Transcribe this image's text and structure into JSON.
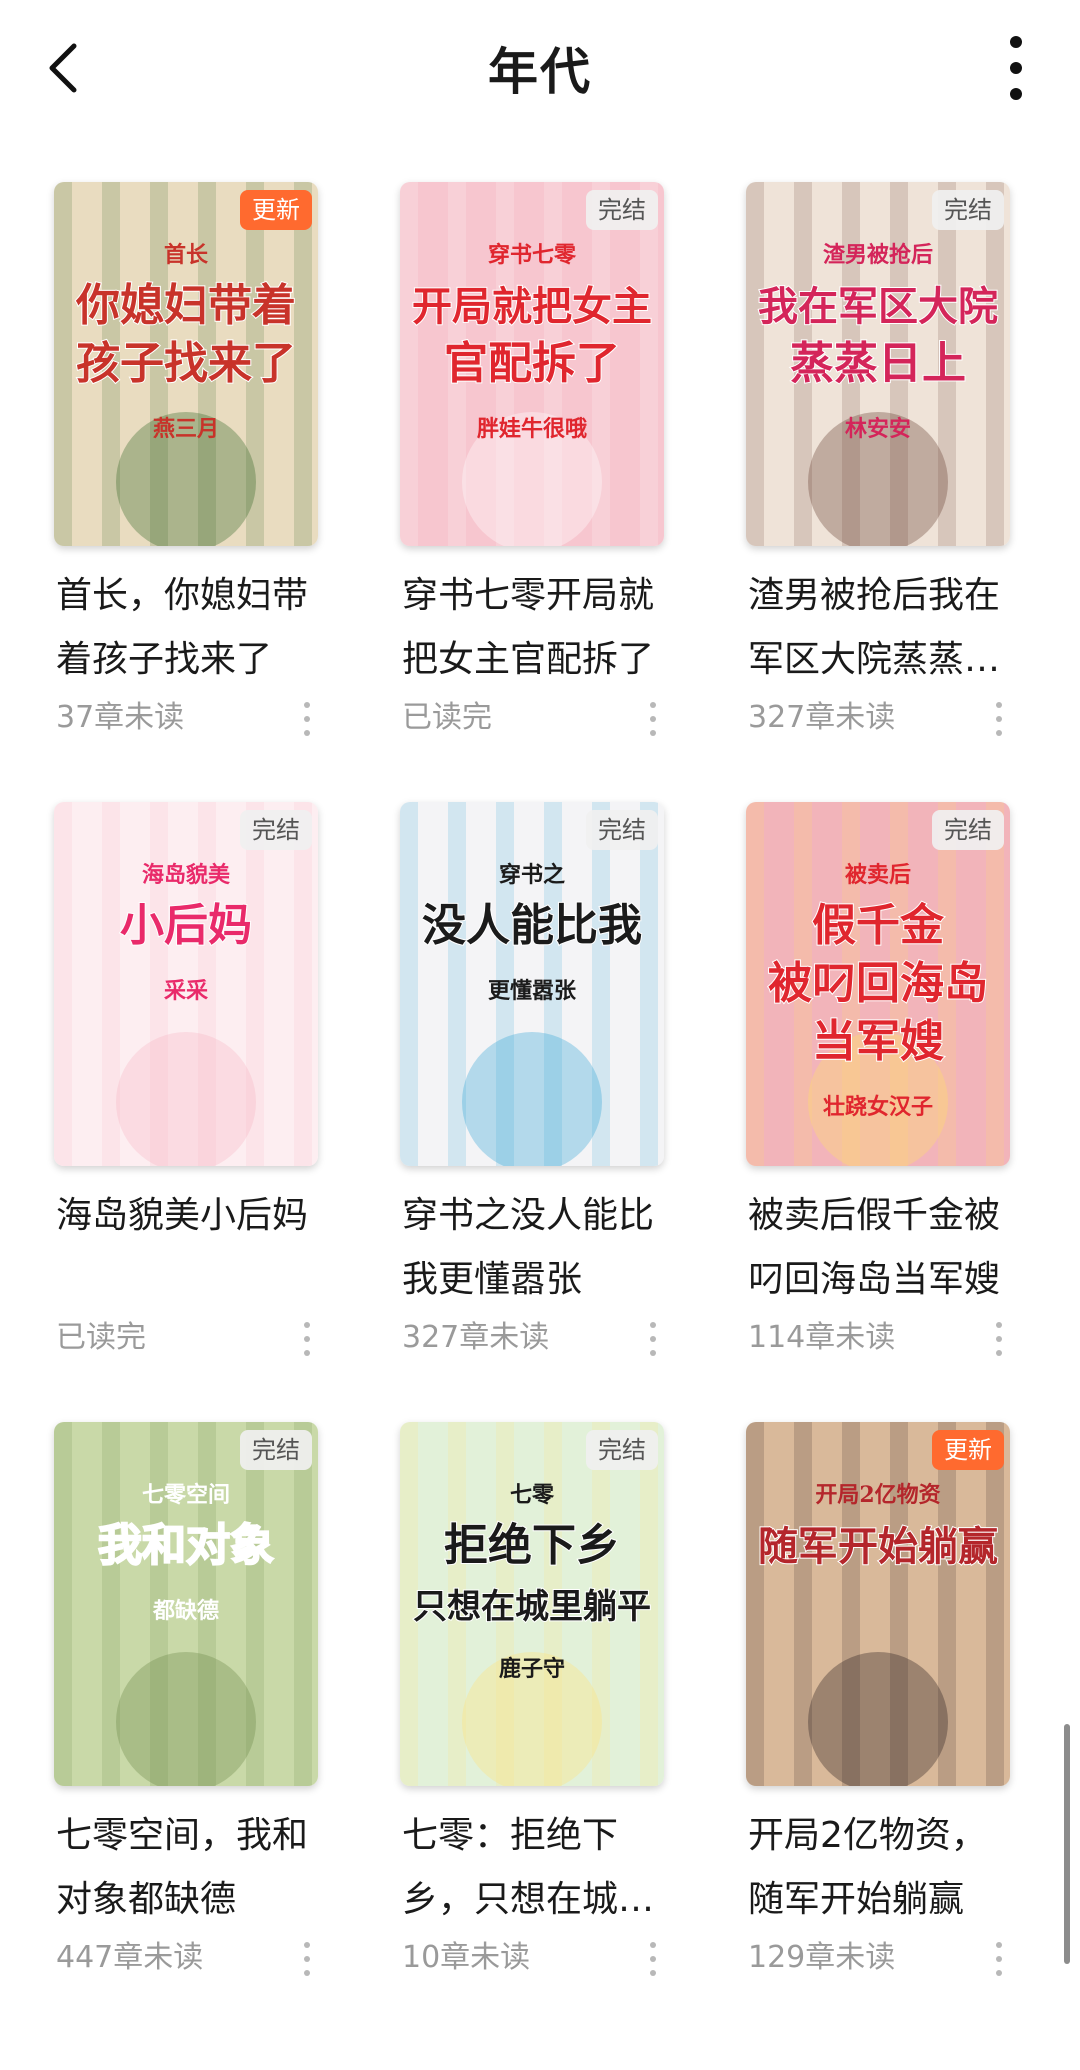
{
  "header": {
    "title": "年代"
  },
  "books": [
    {
      "title": "首长，你媳妇带着孩子找来了",
      "status": "37章未读",
      "badge": "更新",
      "badge_type": "update",
      "cover_text": [
        "首长",
        "你媳妇带着",
        "孩子找来了",
        "燕三月"
      ],
      "colors": [
        "#e9dcc0",
        "#c8332a",
        "#3a6b2a"
      ]
    },
    {
      "title": "穿书七零开局就把女主官配拆了",
      "status": "已读完",
      "badge": "完结",
      "badge_type": "done",
      "cover_text": [
        "穿书七零",
        "开局就把女主",
        "官配拆了",
        "胖娃牛很哦"
      ],
      "colors": [
        "#f7c6cf",
        "#e0262e",
        "#ffffff"
      ]
    },
    {
      "title": "渣男被抢后我在军区大院蒸蒸日上",
      "status": "327章未读",
      "badge": "完结",
      "badge_type": "done",
      "cover_text": [
        "渣男被抢后",
        "我在军区大院",
        "蒸蒸日上",
        "林安安"
      ],
      "colors": [
        "#efe3d8",
        "#d4255a",
        "#6b4336"
      ]
    },
    {
      "title": "海岛貌美小后妈",
      "status": "已读完",
      "badge": "完结",
      "badge_type": "done",
      "cover_text": [
        "海岛貌美",
        "小后妈",
        "采采"
      ],
      "colors": [
        "#fdeef1",
        "#e92a6a",
        "#f7b6c7"
      ]
    },
    {
      "title": "穿书之没人能比我更懂嚣张",
      "status": "327章未读",
      "badge": "完结",
      "badge_type": "done",
      "cover_text": [
        "穿书之",
        "没人能比我",
        "更懂嚣张"
      ],
      "colors": [
        "#f4f4f6",
        "#1b1b1b",
        "#3aa6d6"
      ]
    },
    {
      "title": "被卖后假千金被叼回海岛当军嫂",
      "status": "114章未读",
      "badge": "完结",
      "badge_type": "done",
      "cover_text": [
        "被卖后",
        "假千金",
        "被叼回海岛",
        "当军嫂",
        "壮跷女汉子"
      ],
      "colors": [
        "#f2b4ba",
        "#e0262e",
        "#ffe06a"
      ]
    },
    {
      "title": "七零空间，我和对象都缺德",
      "status": "447章未读",
      "badge": "完结",
      "badge_type": "done",
      "cover_text": [
        "七零空间",
        "我和对象",
        "都缺德"
      ],
      "colors": [
        "#c9d9a8",
        "#ffffff",
        "#6d8a4b"
      ]
    },
    {
      "title": "七零：拒绝下乡，只想在城里躺平",
      "status": "10章未读",
      "badge": "完结",
      "badge_type": "done",
      "cover_text": [
        "七零",
        "拒绝下乡",
        "只想在城里躺平",
        "鹿子守"
      ],
      "colors": [
        "#e2f1d9",
        "#1a1a1a",
        "#ffe27a"
      ]
    },
    {
      "title": "开局2亿物资，随军开始躺赢",
      "status": "129章未读",
      "badge": "更新",
      "badge_type": "update",
      "cover_text": [
        "开局2亿物资",
        "随军开始躺赢"
      ],
      "colors": [
        "#d9b99a",
        "#b4262b",
        "#2a2020"
      ]
    }
  ]
}
